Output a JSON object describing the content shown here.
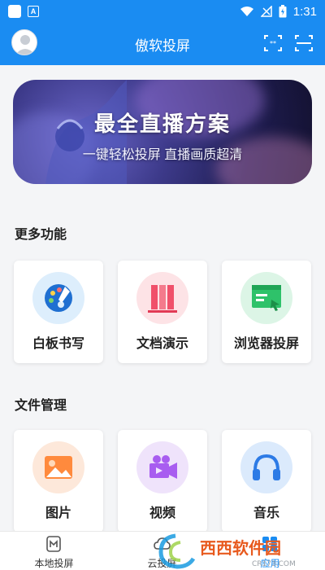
{
  "status_bar": {
    "time": "1:31",
    "a_glyph": "A"
  },
  "header": {
    "title": "傲软投屏",
    "icons": [
      "avatar",
      "remote-code-icon",
      "scan-icon"
    ]
  },
  "banner": {
    "title": "最全直播方案",
    "subtitle": "一键轻松投屏 直播画质超清"
  },
  "sections": {
    "more": {
      "title": "更多功能",
      "items": [
        {
          "label": "白板书写",
          "icon": "palette-icon"
        },
        {
          "label": "文档演示",
          "icon": "documents-icon"
        },
        {
          "label": "浏览器投屏",
          "icon": "browser-icon"
        }
      ]
    },
    "files": {
      "title": "文件管理",
      "items": [
        {
          "label": "图片",
          "icon": "image-icon"
        },
        {
          "label": "视频",
          "icon": "video-icon"
        },
        {
          "label": "音乐",
          "icon": "headphones-icon"
        }
      ]
    }
  },
  "bottom_nav": {
    "items": [
      {
        "label": "本地投屏",
        "active": false
      },
      {
        "label": "云投屏",
        "active": false
      },
      {
        "label": "应用",
        "active": true
      }
    ]
  },
  "watermark": {
    "text": "西西软件园",
    "sub": "CR173.COM"
  },
  "colors": {
    "primary": "#1a8cf2",
    "background": "#f4f5f7"
  }
}
